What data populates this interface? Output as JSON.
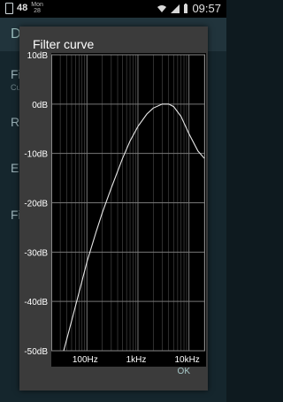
{
  "status_bar": {
    "temperature": "48",
    "date_day": "Mon",
    "date_num": "28",
    "time": "09:57"
  },
  "background_app": {
    "title": "D",
    "items": [
      "Fi",
      "Cu",
      "R",
      "E",
      "Fi"
    ]
  },
  "dialog": {
    "title": "Filter curve",
    "ok_label": "OK"
  },
  "chart_data": {
    "type": "line",
    "title": "",
    "xlabel": "",
    "ylabel": "",
    "x_scale": "log",
    "xlim": [
      20,
      20000
    ],
    "ylim": [
      -50,
      10
    ],
    "y_ticks": [
      "10dB",
      "0dB",
      "-10dB",
      "-20dB",
      "-30dB",
      "-40dB",
      "-50dB"
    ],
    "y_tick_values": [
      10,
      0,
      -10,
      -20,
      -30,
      -40,
      -50
    ],
    "x_ticks": [
      "100Hz",
      "1kHz",
      "10kHz"
    ],
    "x_tick_values": [
      100,
      1000,
      10000
    ],
    "grid": true,
    "series": [
      {
        "x": [
          35,
          50,
          75,
          100,
          150,
          200,
          300,
          500,
          700,
          1000,
          1500,
          2000,
          3000,
          4000,
          5000,
          7000,
          10000,
          15000,
          20000
        ],
        "y": [
          -50,
          -44,
          -37,
          -32,
          -26,
          -22,
          -17,
          -11,
          -7.5,
          -4.5,
          -2,
          -0.8,
          0,
          0,
          -0.5,
          -2.5,
          -6,
          -9.5,
          -11
        ]
      }
    ]
  }
}
